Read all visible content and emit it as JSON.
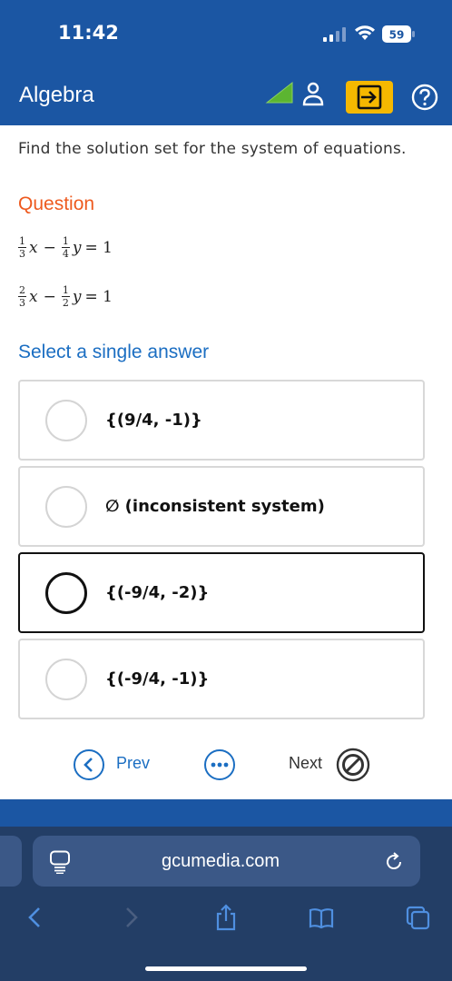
{
  "status": {
    "time": "11:42",
    "battery": "59"
  },
  "header": {
    "title": "Algebra"
  },
  "instruction": "Find the solution set for the system of equations.",
  "question": {
    "heading": "Question",
    "eq1": {
      "a_num": "1",
      "a_den": "3",
      "var1": "x",
      "op": "−",
      "b_num": "1",
      "b_den": "4",
      "var2": "y",
      "rhs": "= 1"
    },
    "eq2": {
      "a_num": "2",
      "a_den": "3",
      "var1": "x",
      "op": "−",
      "b_num": "1",
      "b_den": "2",
      "var2": "y",
      "rhs": "= 1"
    }
  },
  "answers": {
    "heading": "Select a single answer",
    "options": [
      {
        "label": "{(9/4, -1)}"
      },
      {
        "label": "∅ (inconsistent system)"
      },
      {
        "label": "{(-9/4, -2)}"
      },
      {
        "label": "{(-9/4, -1)}"
      }
    ]
  },
  "nav": {
    "prev_label": "Prev",
    "next_label": "Next"
  },
  "browser": {
    "url": "gcumedia.com"
  },
  "colors": {
    "brand": "#1b56a3",
    "accent_orange": "#ee5a1f",
    "link_blue": "#1b6ec2",
    "exit_yellow": "#f5b800"
  }
}
